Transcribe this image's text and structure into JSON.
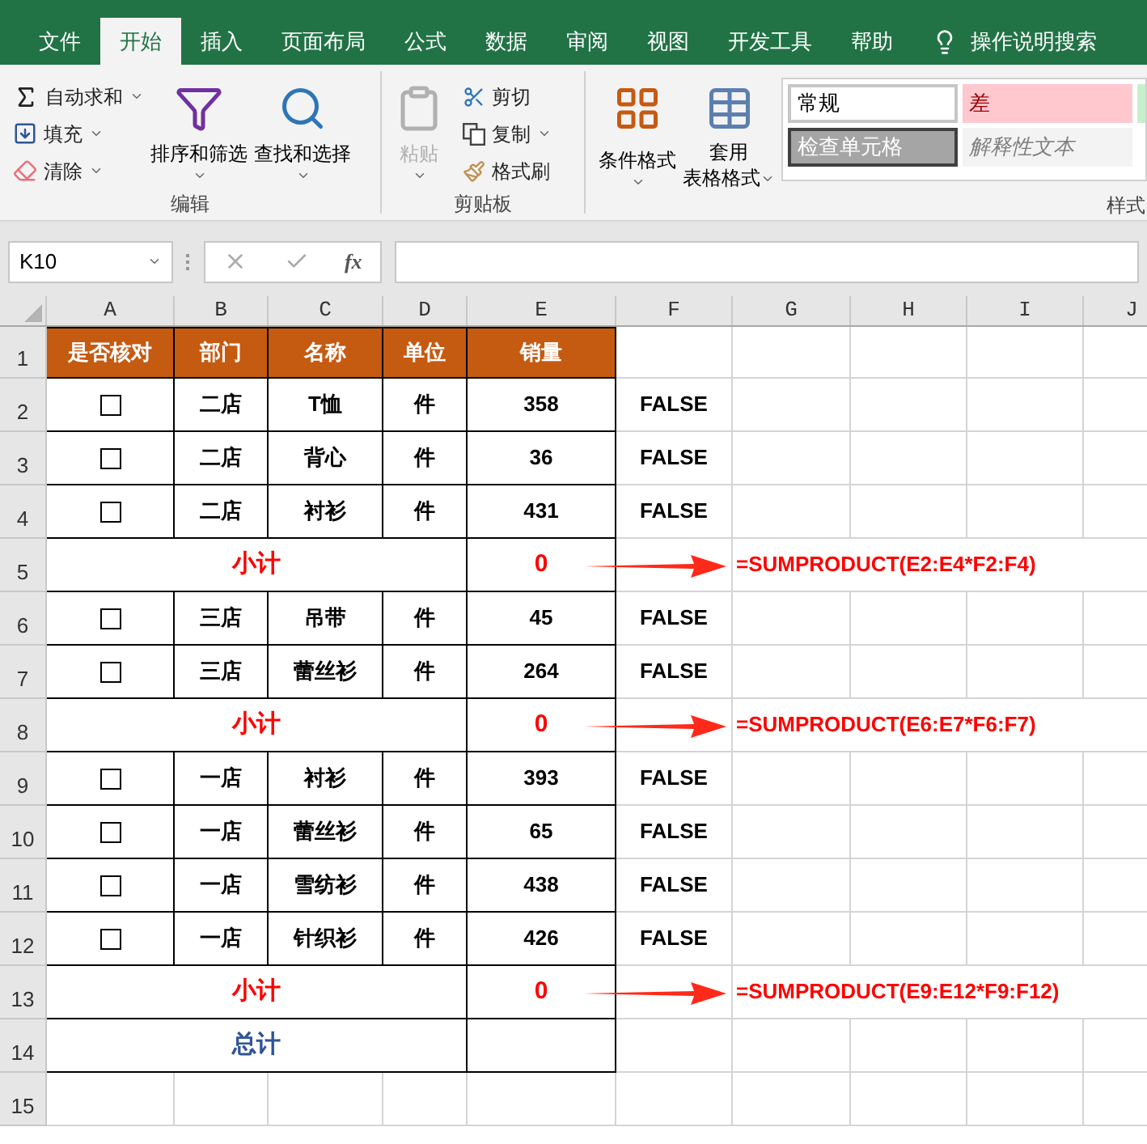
{
  "tabs": [
    {
      "label": "文件",
      "selected": false
    },
    {
      "label": "开始",
      "selected": true
    },
    {
      "label": "插入",
      "selected": false
    },
    {
      "label": "页面布局",
      "selected": false
    },
    {
      "label": "公式",
      "selected": false
    },
    {
      "label": "数据",
      "selected": false
    },
    {
      "label": "审阅",
      "selected": false
    },
    {
      "label": "视图",
      "selected": false
    },
    {
      "label": "开发工具",
      "selected": false
    },
    {
      "label": "帮助",
      "selected": false
    }
  ],
  "tell_me": "操作说明搜索",
  "ribbon": {
    "editing": {
      "label": "编辑",
      "autosum": "自动求和",
      "fill": "填充",
      "clear": "清除",
      "sort_filter": "排序和筛选",
      "find_select": "查找和选择"
    },
    "clipboard": {
      "label": "剪贴板",
      "paste": {
        "label": "粘贴",
        "disabled": true
      },
      "cut": "剪切",
      "copy": "复制",
      "format_painter": "格式刷"
    },
    "styles": {
      "label": "样式",
      "conditional": "条件格式",
      "table_format": [
        "套用",
        "表格格式"
      ],
      "cells": [
        {
          "label": "常规",
          "kind": "normal"
        },
        {
          "label": "差",
          "kind": "bad"
        },
        {
          "kind": "good"
        },
        {
          "label": "检查单元格",
          "kind": "check"
        },
        {
          "label": "解释性文本",
          "kind": "explanatory"
        }
      ]
    }
  },
  "formula_bar": {
    "name_box": "K10",
    "function_label": "fx"
  },
  "columns": [
    "A",
    "B",
    "C",
    "D",
    "E",
    "F",
    "G",
    "H",
    "I",
    "J"
  ],
  "rows": [
    {
      "number": "1",
      "kind": "header",
      "cells": [
        "是否核对",
        "部门",
        "名称",
        "单位",
        "销量"
      ]
    },
    {
      "number": "2",
      "kind": "item",
      "checked": false,
      "department": "二店",
      "name": "T恤",
      "unit": "件",
      "quantity": "358",
      "result": "FALSE"
    },
    {
      "number": "3",
      "kind": "item",
      "checked": false,
      "department": "二店",
      "name": "背心",
      "unit": "件",
      "quantity": "36",
      "result": "FALSE"
    },
    {
      "number": "4",
      "kind": "item",
      "checked": false,
      "department": "二店",
      "name": "衬衫",
      "unit": "件",
      "quantity": "431",
      "result": "FALSE"
    },
    {
      "number": "5",
      "kind": "subtotal",
      "label": "小计",
      "value": "0",
      "formula": "=SUMPRODUCT(E2:E4*F2:F4)"
    },
    {
      "number": "6",
      "kind": "item",
      "checked": false,
      "department": "三店",
      "name": "吊带",
      "unit": "件",
      "quantity": "45",
      "result": "FALSE"
    },
    {
      "number": "7",
      "kind": "item",
      "checked": false,
      "department": "三店",
      "name": "蕾丝衫",
      "unit": "件",
      "quantity": "264",
      "result": "FALSE"
    },
    {
      "number": "8",
      "kind": "subtotal",
      "label": "小计",
      "value": "0",
      "formula": "=SUMPRODUCT(E6:E7*F6:F7)"
    },
    {
      "number": "9",
      "kind": "item",
      "checked": false,
      "department": "一店",
      "name": "衬衫",
      "unit": "件",
      "quantity": "393",
      "result": "FALSE"
    },
    {
      "number": "10",
      "kind": "item",
      "checked": false,
      "department": "一店",
      "name": "蕾丝衫",
      "unit": "件",
      "quantity": "65",
      "result": "FALSE"
    },
    {
      "number": "11",
      "kind": "item",
      "checked": false,
      "department": "一店",
      "name": "雪纺衫",
      "unit": "件",
      "quantity": "438",
      "result": "FALSE"
    },
    {
      "number": "12",
      "kind": "item",
      "checked": false,
      "department": "一店",
      "name": "针织衫",
      "unit": "件",
      "quantity": "426",
      "result": "FALSE"
    },
    {
      "number": "13",
      "kind": "subtotal",
      "label": "小计",
      "value": "0",
      "formula": "=SUMPRODUCT(E9:E12*F9:F12)"
    },
    {
      "number": "14",
      "kind": "total",
      "label": "总计"
    },
    {
      "number": "15",
      "kind": "empty"
    }
  ]
}
